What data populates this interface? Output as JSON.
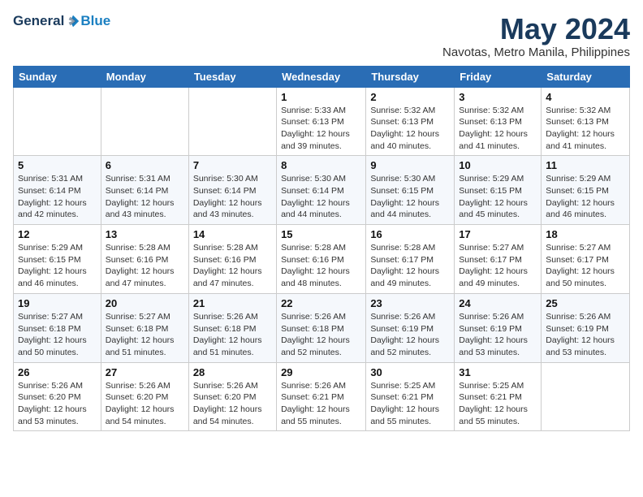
{
  "header": {
    "logo_general": "General",
    "logo_blue": "Blue",
    "month_title": "May 2024",
    "location": "Navotas, Metro Manila, Philippines"
  },
  "weekdays": [
    "Sunday",
    "Monday",
    "Tuesday",
    "Wednesday",
    "Thursday",
    "Friday",
    "Saturday"
  ],
  "weeks": [
    [
      {
        "day": "",
        "info": ""
      },
      {
        "day": "",
        "info": ""
      },
      {
        "day": "",
        "info": ""
      },
      {
        "day": "1",
        "info": "Sunrise: 5:33 AM\nSunset: 6:13 PM\nDaylight: 12 hours\nand 39 minutes."
      },
      {
        "day": "2",
        "info": "Sunrise: 5:32 AM\nSunset: 6:13 PM\nDaylight: 12 hours\nand 40 minutes."
      },
      {
        "day": "3",
        "info": "Sunrise: 5:32 AM\nSunset: 6:13 PM\nDaylight: 12 hours\nand 41 minutes."
      },
      {
        "day": "4",
        "info": "Sunrise: 5:32 AM\nSunset: 6:13 PM\nDaylight: 12 hours\nand 41 minutes."
      }
    ],
    [
      {
        "day": "5",
        "info": "Sunrise: 5:31 AM\nSunset: 6:14 PM\nDaylight: 12 hours\nand 42 minutes."
      },
      {
        "day": "6",
        "info": "Sunrise: 5:31 AM\nSunset: 6:14 PM\nDaylight: 12 hours\nand 43 minutes."
      },
      {
        "day": "7",
        "info": "Sunrise: 5:30 AM\nSunset: 6:14 PM\nDaylight: 12 hours\nand 43 minutes."
      },
      {
        "day": "8",
        "info": "Sunrise: 5:30 AM\nSunset: 6:14 PM\nDaylight: 12 hours\nand 44 minutes."
      },
      {
        "day": "9",
        "info": "Sunrise: 5:30 AM\nSunset: 6:15 PM\nDaylight: 12 hours\nand 44 minutes."
      },
      {
        "day": "10",
        "info": "Sunrise: 5:29 AM\nSunset: 6:15 PM\nDaylight: 12 hours\nand 45 minutes."
      },
      {
        "day": "11",
        "info": "Sunrise: 5:29 AM\nSunset: 6:15 PM\nDaylight: 12 hours\nand 46 minutes."
      }
    ],
    [
      {
        "day": "12",
        "info": "Sunrise: 5:29 AM\nSunset: 6:15 PM\nDaylight: 12 hours\nand 46 minutes."
      },
      {
        "day": "13",
        "info": "Sunrise: 5:28 AM\nSunset: 6:16 PM\nDaylight: 12 hours\nand 47 minutes."
      },
      {
        "day": "14",
        "info": "Sunrise: 5:28 AM\nSunset: 6:16 PM\nDaylight: 12 hours\nand 47 minutes."
      },
      {
        "day": "15",
        "info": "Sunrise: 5:28 AM\nSunset: 6:16 PM\nDaylight: 12 hours\nand 48 minutes."
      },
      {
        "day": "16",
        "info": "Sunrise: 5:28 AM\nSunset: 6:17 PM\nDaylight: 12 hours\nand 49 minutes."
      },
      {
        "day": "17",
        "info": "Sunrise: 5:27 AM\nSunset: 6:17 PM\nDaylight: 12 hours\nand 49 minutes."
      },
      {
        "day": "18",
        "info": "Sunrise: 5:27 AM\nSunset: 6:17 PM\nDaylight: 12 hours\nand 50 minutes."
      }
    ],
    [
      {
        "day": "19",
        "info": "Sunrise: 5:27 AM\nSunset: 6:18 PM\nDaylight: 12 hours\nand 50 minutes."
      },
      {
        "day": "20",
        "info": "Sunrise: 5:27 AM\nSunset: 6:18 PM\nDaylight: 12 hours\nand 51 minutes."
      },
      {
        "day": "21",
        "info": "Sunrise: 5:26 AM\nSunset: 6:18 PM\nDaylight: 12 hours\nand 51 minutes."
      },
      {
        "day": "22",
        "info": "Sunrise: 5:26 AM\nSunset: 6:18 PM\nDaylight: 12 hours\nand 52 minutes."
      },
      {
        "day": "23",
        "info": "Sunrise: 5:26 AM\nSunset: 6:19 PM\nDaylight: 12 hours\nand 52 minutes."
      },
      {
        "day": "24",
        "info": "Sunrise: 5:26 AM\nSunset: 6:19 PM\nDaylight: 12 hours\nand 53 minutes."
      },
      {
        "day": "25",
        "info": "Sunrise: 5:26 AM\nSunset: 6:19 PM\nDaylight: 12 hours\nand 53 minutes."
      }
    ],
    [
      {
        "day": "26",
        "info": "Sunrise: 5:26 AM\nSunset: 6:20 PM\nDaylight: 12 hours\nand 53 minutes."
      },
      {
        "day": "27",
        "info": "Sunrise: 5:26 AM\nSunset: 6:20 PM\nDaylight: 12 hours\nand 54 minutes."
      },
      {
        "day": "28",
        "info": "Sunrise: 5:26 AM\nSunset: 6:20 PM\nDaylight: 12 hours\nand 54 minutes."
      },
      {
        "day": "29",
        "info": "Sunrise: 5:26 AM\nSunset: 6:21 PM\nDaylight: 12 hours\nand 55 minutes."
      },
      {
        "day": "30",
        "info": "Sunrise: 5:25 AM\nSunset: 6:21 PM\nDaylight: 12 hours\nand 55 minutes."
      },
      {
        "day": "31",
        "info": "Sunrise: 5:25 AM\nSunset: 6:21 PM\nDaylight: 12 hours\nand 55 minutes."
      },
      {
        "day": "",
        "info": ""
      }
    ]
  ]
}
